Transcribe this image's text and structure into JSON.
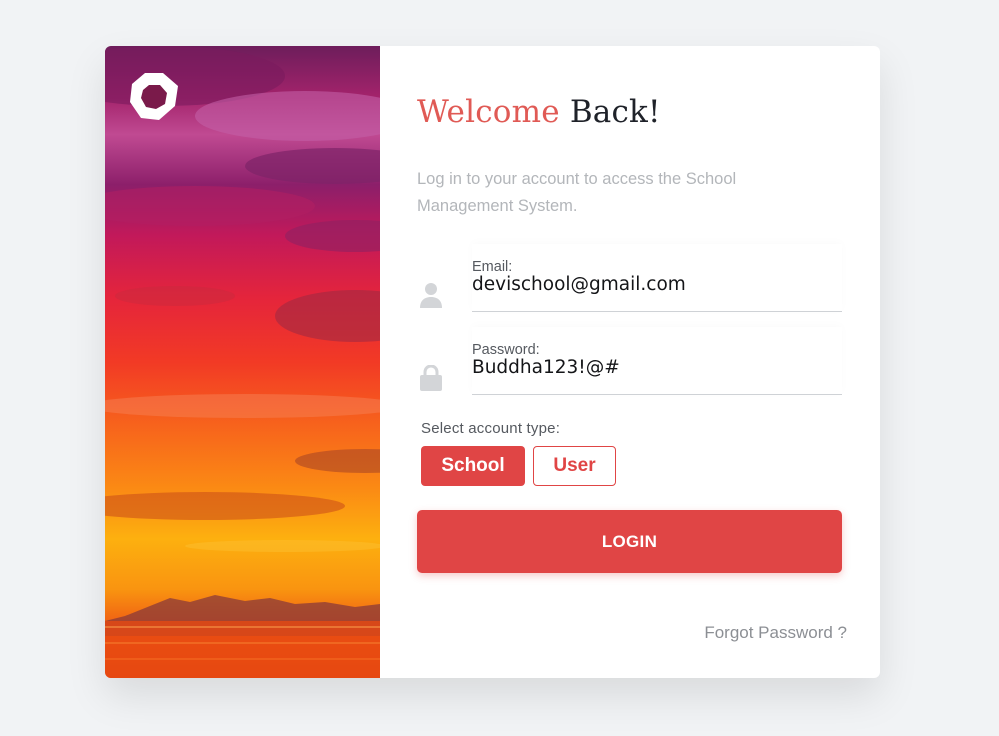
{
  "brand": {
    "logo_icon": "hexagon-ring-logo-icon"
  },
  "hero": {
    "image": "sunset-over-sea-image"
  },
  "heading": {
    "accent": "Welcome",
    "rest": "Back!",
    "accent_color": "#e05a55"
  },
  "subtitle": "Log in to your account to access the School Management System.",
  "email": {
    "label": "Email:",
    "value": "devischool@gmail.com",
    "icon": "user-icon"
  },
  "password": {
    "label": "Password:",
    "value": "Buddha123!@#",
    "icon": "lock-icon"
  },
  "account_type": {
    "label": "Select account type:",
    "options": [
      "School",
      "User"
    ],
    "selected": "School"
  },
  "login_label": "LOGIN",
  "forgot_label": "Forgot Password ?",
  "colors": {
    "primary": "#e04545",
    "background": "#f1f3f5",
    "muted_text": "#b3b6ba"
  }
}
